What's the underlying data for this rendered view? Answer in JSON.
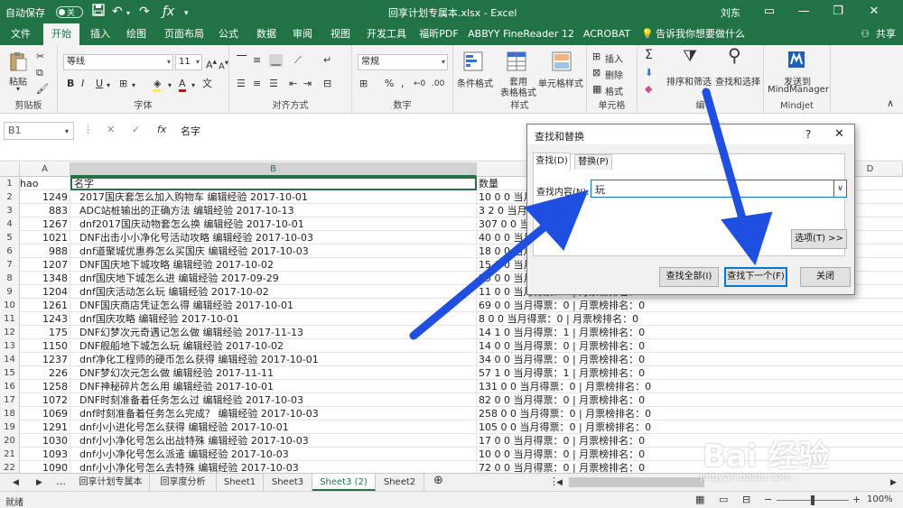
{
  "titlebar": {
    "autosave_label": "自动保存",
    "autosave_state": "关",
    "file_title": "回享计划专属本.xlsx - Excel",
    "user": "刘东"
  },
  "tabs": [
    "文件",
    "开始",
    "插入",
    "绘图",
    "页面布局",
    "公式",
    "数据",
    "审阅",
    "视图",
    "开发工具",
    "福昕PDF",
    "ABBYY FineReader 12",
    "ACROBAT"
  ],
  "active_tab": "开始",
  "tell_me": "告诉我你想要做什么",
  "share": "共享",
  "ribbon": {
    "clipboard": {
      "paste": "粘贴",
      "label": "剪贴板"
    },
    "font": {
      "name": "等线",
      "size": "11",
      "label": "字体"
    },
    "alignment": {
      "label": "对齐方式"
    },
    "number": {
      "format": "常规",
      "label": "数字"
    },
    "styles": {
      "cond_format": "条件格式",
      "table_format_1": "套用",
      "table_format_2": "表格格式",
      "cell_styles": "单元格样式",
      "label": "样式"
    },
    "cells": {
      "insert": "插入",
      "delete": "删除",
      "format": "格式",
      "label": "单元格"
    },
    "editing": {
      "sort_filter": "排序和筛选",
      "find_select": "查找和选择",
      "label": "编"
    },
    "mindjet": {
      "send_1": "发送到",
      "send_2": "MindManager",
      "label": "Mindjet"
    }
  },
  "formula_bar": {
    "name_box": "B1",
    "content": "名字"
  },
  "columns": [
    "A",
    "B",
    "D"
  ],
  "rows": [
    {
      "n": "1",
      "a": "hao",
      "b": "名字",
      "c": "数量"
    },
    {
      "n": "2",
      "a": "1249",
      "b": "2017国庆套怎么加入购物车 编辑经验 2017-10-01",
      "c": "10 0 0 当月得"
    },
    {
      "n": "3",
      "a": "883",
      "b": "ADC站桩输出的正确方法 编辑经验 2017-10-13",
      "c": "3 2 0 当月得"
    },
    {
      "n": "4",
      "a": "1267",
      "b": "dnf2017国庆动物套怎么换 编辑经验 2017-10-01",
      "c": "307 0 0 当月"
    },
    {
      "n": "5",
      "a": "1021",
      "b": "DNF出击小小净化号活动攻略 编辑经验 2017-10-03",
      "c": "40 0 0 当月得"
    },
    {
      "n": "6",
      "a": "988",
      "b": "dnf道聚城优惠券怎么买国庆 编辑经验 2017-10-03",
      "c": "18 0 0 当月得"
    },
    {
      "n": "7",
      "a": "1207",
      "b": "DNF国庆地下城攻略 编辑经验 2017-10-02",
      "c": "15 0 0 当月得"
    },
    {
      "n": "8",
      "a": "1348",
      "b": "dnf国庆地下城怎么进 编辑经验 2017-09-29",
      "c": "25 0 0 当月得"
    },
    {
      "n": "9",
      "a": "1204",
      "b": "dnf国庆活动怎么玩 编辑经验 2017-10-02",
      "c": "11 0 0 当月得票：0 | 月票榜排名：0"
    },
    {
      "n": "10",
      "a": "1261",
      "b": "DNF国庆商店凭证怎么得 编辑经验 2017-10-01",
      "c": "69 0 0 当月得票：0 | 月票榜排名：0"
    },
    {
      "n": "11",
      "a": "1243",
      "b": "dnf国庆攻略 编辑经验 2017-10-01",
      "c": "8 0 0 当月得票：0 | 月票榜排名：0"
    },
    {
      "n": "12",
      "a": "175",
      "b": "DNF幻梦次元奇遇记怎么做 编辑经验 2017-11-13",
      "c": "14 1 0 当月得票：1 | 月票榜排名：0"
    },
    {
      "n": "13",
      "a": "1150",
      "b": "DNF舰船地下城怎么玩 编辑经验 2017-10-02",
      "c": "14 0 0 当月得票：0 | 月票榜排名：0"
    },
    {
      "n": "14",
      "a": "1237",
      "b": "dnf净化工程师的硬币怎么获得 编辑经验 2017-10-01",
      "c": "34 0 0 当月得票：0 | 月票榜排名：0"
    },
    {
      "n": "15",
      "a": "226",
      "b": "DNF梦幻次元怎么做 编辑经验 2017-11-11",
      "c": "57 1 0 当月得票：1 | 月票榜排名：0"
    },
    {
      "n": "16",
      "a": "1258",
      "b": "DNF神秘碎片怎么用 编辑经验 2017-10-01",
      "c": "131 0 0 当月得票：0 | 月票榜排名：0"
    },
    {
      "n": "17",
      "a": "1072",
      "b": "DNF时刻准备着任务怎么过 编辑经验 2017-10-03",
      "c": "82 0 0 当月得票：0 | 月票榜排名：0"
    },
    {
      "n": "18",
      "a": "1069",
      "b": "dnf时刻准备着任务怎么完成？ 编辑经验 2017-10-03",
      "c": "258 0 0 当月得票：0 | 月票榜排名：0"
    },
    {
      "n": "19",
      "a": "1291",
      "b": "dnf小小进化号怎么获得 编辑经验 2017-10-01",
      "c": "105 0 0 当月得票：0 | 月票榜排名：0"
    },
    {
      "n": "20",
      "a": "1030",
      "b": "dnf小小净化号怎么出战特殊 编辑经验 2017-10-03",
      "c": "17 0 0 当月得票：0 | 月票榜排名：0"
    },
    {
      "n": "21",
      "a": "1093",
      "b": "dnf小小净化号怎么派遣 编辑经验 2017-10-03",
      "c": "10 0 0 当月得票：0 | 月票榜排名：0"
    },
    {
      "n": "22",
      "a": "1090",
      "b": "dnf小小净化号怎么去特殊 编辑经验 2017-10-03",
      "c": "72 0 0 当月得票：0 | 月票榜排名：0"
    }
  ],
  "sheet_tabs": [
    "回享计划专属本",
    "回享度分析",
    "Sheet1",
    "Sheet3",
    "Sheet3 (2)",
    "Sheet2"
  ],
  "active_sheet": "Sheet3 (2)",
  "statusbar": {
    "status": "就绪",
    "zoom": "100%"
  },
  "dialog": {
    "title": "查找和替换",
    "help": "?",
    "tab_find": "查找(D)",
    "tab_replace": "替换(P)",
    "find_label": "查找内容(N):",
    "find_value": "玩",
    "options": "选项(T) >>",
    "find_all": "查找全部(I)",
    "find_next": "查找下一个(F)",
    "close": "关闭"
  },
  "watermark": {
    "main": "Bai 经验",
    "sub": "jingyan.baidu.com"
  },
  "colors": {
    "excel_green": "#217346",
    "arrow_blue": "#1f4fe0",
    "selection": "#217346"
  }
}
